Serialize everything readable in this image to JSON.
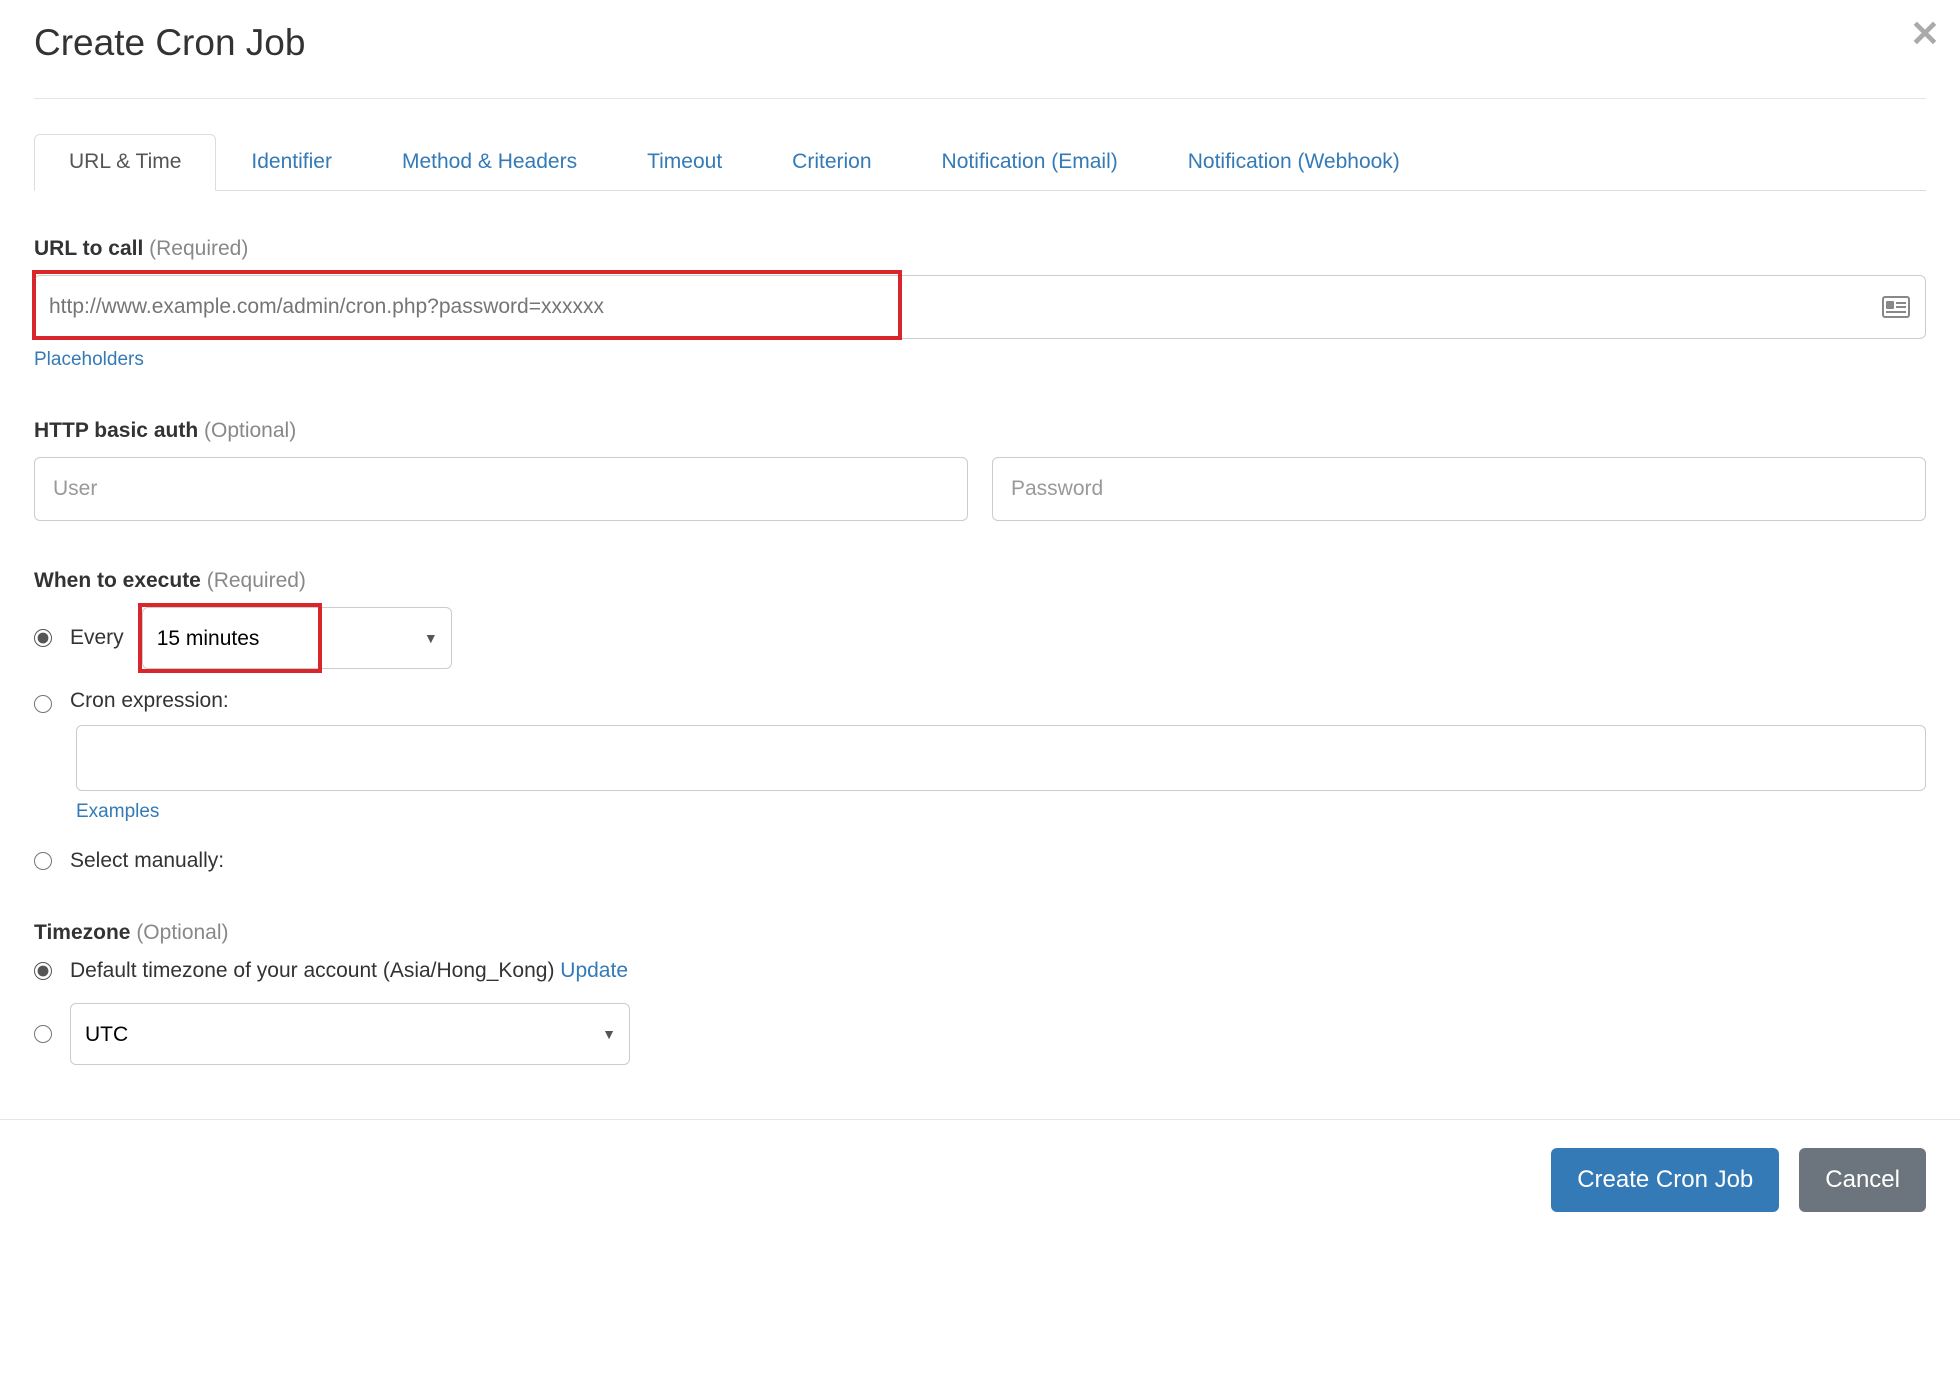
{
  "modal": {
    "title": "Create Cron Job"
  },
  "tabs": [
    {
      "label": "URL & Time",
      "active": true
    },
    {
      "label": "Identifier"
    },
    {
      "label": "Method & Headers"
    },
    {
      "label": "Timeout"
    },
    {
      "label": "Criterion"
    },
    {
      "label": "Notification (Email)"
    },
    {
      "label": "Notification (Webhook)"
    }
  ],
  "url_section": {
    "label_main": "URL to call",
    "label_hint": "(Required)",
    "placeholder": "http://www.example.com/admin/cron.php?password=xxxxxx",
    "value": "",
    "link": "Placeholders"
  },
  "auth_section": {
    "label_main": "HTTP basic auth",
    "label_hint": "(Optional)",
    "user_placeholder": "User",
    "password_placeholder": "Password"
  },
  "when_section": {
    "label_main": "When to execute",
    "label_hint": "(Required)",
    "every_label": "Every",
    "every_select": "15 minutes",
    "cron_label": "Cron expression:",
    "cron_value": "",
    "examples_link": "Examples",
    "manual_label": "Select manually:"
  },
  "tz_section": {
    "label_main": "Timezone",
    "label_hint": "(Optional)",
    "default_label": "Default timezone of your account (Asia/Hong_Kong) ",
    "update": "Update",
    "utc_select": "UTC"
  },
  "footer": {
    "primary": "Create Cron Job",
    "secondary": "Cancel"
  }
}
